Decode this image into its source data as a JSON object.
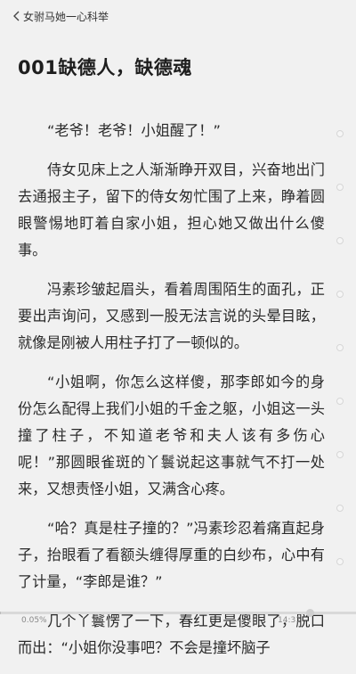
{
  "header": {
    "back_label": "女驸马她一心科举"
  },
  "chapter": {
    "title": "001缺德人，缺德魂"
  },
  "paragraphs": [
    "“老爷！老爷！小姐醒了！”",
    "侍女见床上之人渐渐睁开双目，兴奋地出门去通报主子，留下的侍女匆忙围了上来，睁着圆眼警惕地盯着自家小姐，担心她又做出什么傻事。",
    "冯素珍皱起眉头，看着周围陌生的面孔，正要出声询问，又感到一股无法言说的头晕目眩，就像是刚被人用柱子打了一顿似的。",
    "“小姐啊，你怎么这样傻，那李郎如今的身份怎么配得上我们小姐的千金之躯，小姐这一头撞了柱子，不知道老爷和夫人该有多伤心呢！”那圆眼雀斑的丫鬟说起这事就气不打一处来，又想责怪小姐，又满含心疼。",
    "“哈？真是柱子撞的？”冯素珍忍着痛直起身子，抬眼看了看额头缠得厚重的白纱布，心中有了计量，“李郎是谁？”",
    "几个丫鬟愣了一下，春红更是傻眼了，脱口而出：“小姐你没事吧？不会是撞坏脑子"
  ],
  "footer": {
    "progress_text": "0.05%",
    "progress_value": 0.0005,
    "time": "14:31"
  },
  "icons": {
    "back": "chevron-left-icon"
  }
}
